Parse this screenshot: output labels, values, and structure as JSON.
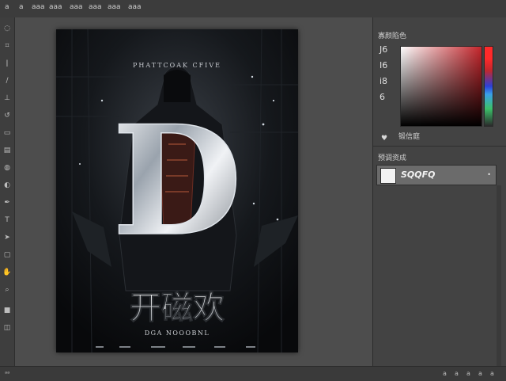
{
  "menubar": {
    "items": [
      "a",
      "a",
      "aaa",
      "aaa",
      "aaa",
      "aaa",
      "aaa",
      "aaa"
    ]
  },
  "toolbox": {
    "tools": [
      "lasso-icon",
      "crop-icon",
      "eyedropper-icon",
      "brush-icon",
      "stamp-icon",
      "history-brush-icon",
      "eraser-icon",
      "gradient-icon",
      "blur-icon",
      "dodge-icon",
      "pen-icon",
      "type-icon",
      "path-select-icon",
      "shape-icon",
      "hand-icon",
      "zoom-icon",
      "colors-icon",
      "quickmask-icon"
    ]
  },
  "document": {
    "top_text": "PHATTCOAK CFIVE",
    "title_cn": "开磁欢",
    "subtitle": "DGA NOOOBNL",
    "logo_letter": "D"
  },
  "color_panel": {
    "title": "寡颜陷色",
    "left_labels": [
      "J6",
      "I6",
      "i8",
      "6"
    ],
    "footer_label": "锻信庭",
    "colors": {
      "gradient_main": "#c4252b",
      "hue_top": "#ff2a2a"
    }
  },
  "layers_panel": {
    "title": "预调资成",
    "layer_name": "SQQFQ"
  },
  "statusbar": {
    "left": "ᵃᵃ",
    "right_items": [
      "a",
      "a",
      "a",
      "a",
      "a"
    ]
  }
}
